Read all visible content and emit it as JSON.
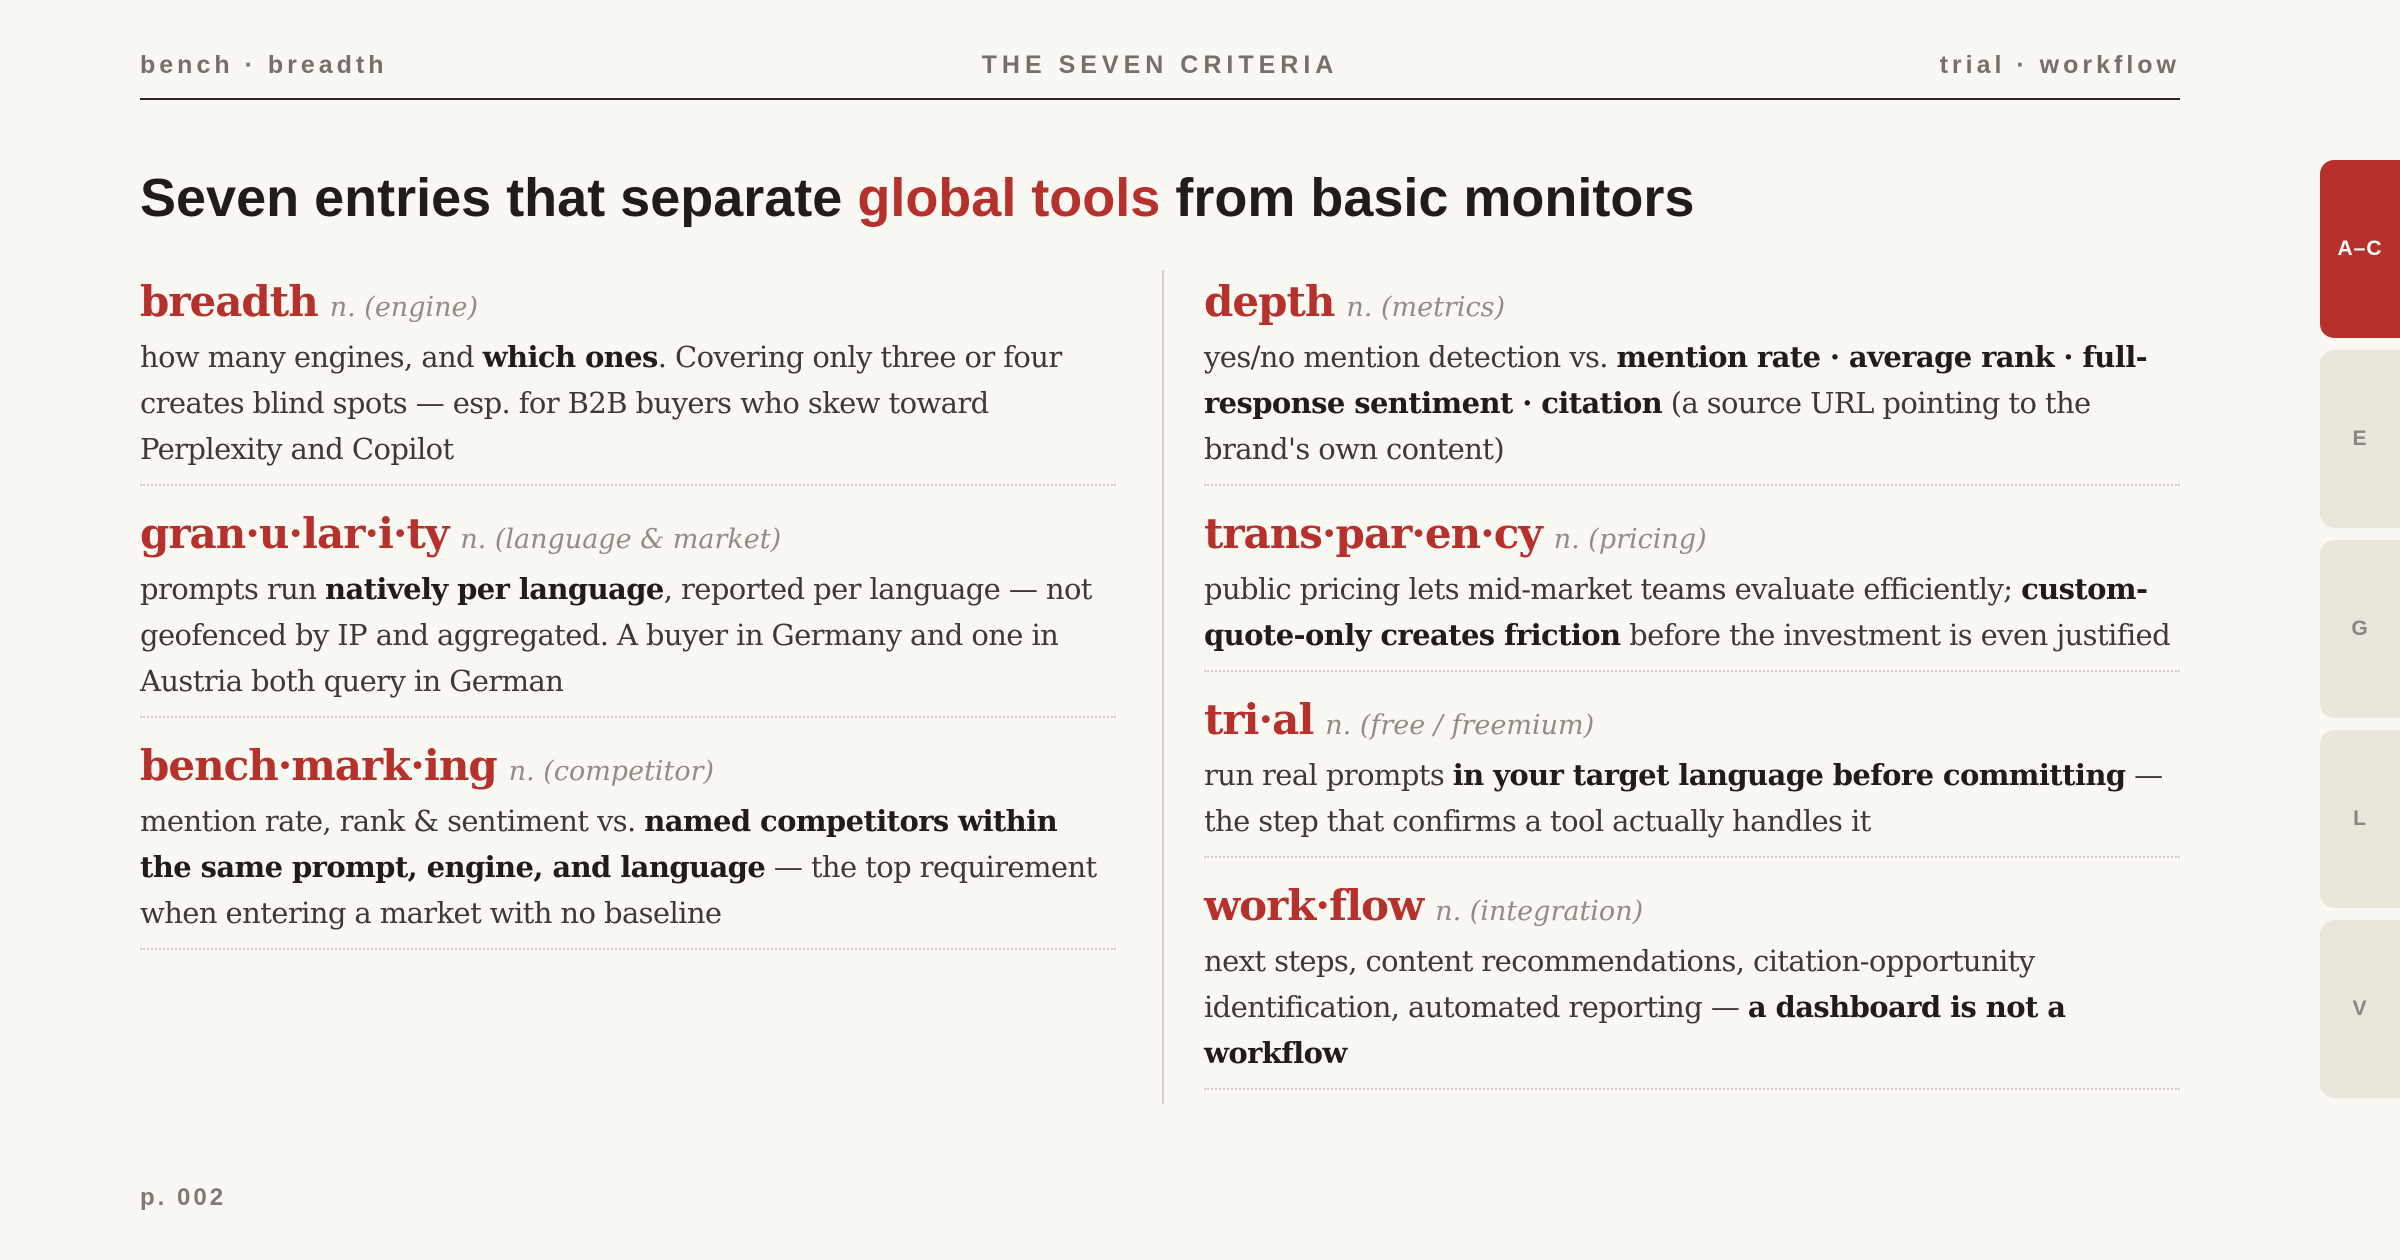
{
  "header": {
    "left": "bench · breadth",
    "center": "THE SEVEN CRITERIA",
    "right": "trial · workflow"
  },
  "headline": {
    "before": "Seven entries that separate ",
    "accent": "global tools",
    "after": " from basic monitors"
  },
  "entries_left": [
    {
      "term": "breadth",
      "pos": "n. (engine)",
      "def": [
        {
          "t": "how many engines, and "
        },
        {
          "t": "which ones",
          "b": true
        },
        {
          "t": ". Covering only three or four creates blind spots — esp. for B2B buyers who skew toward Perplexity and Copilot"
        }
      ]
    },
    {
      "term": "gran·u·lar·i·ty",
      "pos": "n. (language & market)",
      "def": [
        {
          "t": "prompts run "
        },
        {
          "t": "natively per language",
          "b": true
        },
        {
          "t": ", reported per language — not geofenced by IP and aggregated. A buyer in Germany and one in Austria both query in German"
        }
      ]
    },
    {
      "term": "bench·mark·ing",
      "pos": "n. (competitor)",
      "def": [
        {
          "t": "mention rate, rank & sentiment vs. "
        },
        {
          "t": "named competitors within the same prompt, engine, and language",
          "b": true
        },
        {
          "t": " — the top requirement when entering a market with no baseline"
        }
      ]
    }
  ],
  "entries_right": [
    {
      "term": "depth",
      "pos": "n. (metrics)",
      "def": [
        {
          "t": "yes/no mention detection vs. "
        },
        {
          "t": "mention rate · average rank · full-response sentiment · citation",
          "b": true
        },
        {
          "t": " (a source URL pointing to the brand's own content)"
        }
      ]
    },
    {
      "term": "trans·par·en·cy",
      "pos": "n. (pricing)",
      "def": [
        {
          "t": "public pricing lets mid-market teams evaluate efficiently; "
        },
        {
          "t": "custom-quote-only creates friction",
          "b": true
        },
        {
          "t": " before the investment is even justified"
        }
      ]
    },
    {
      "term": "tri·al",
      "pos": "n. (free / freemium)",
      "def": [
        {
          "t": "run real prompts "
        },
        {
          "t": "in your target language before committing",
          "b": true
        },
        {
          "t": " — the step that confirms a tool actually handles it"
        }
      ]
    },
    {
      "term": "work·flow",
      "pos": "n. (integration)",
      "def": [
        {
          "t": "next steps, content recommendations, citation-opportunity identification, automated reporting — "
        },
        {
          "t": "a dashboard is not a workflow",
          "b": true
        }
      ]
    }
  ],
  "tabs": [
    {
      "label": "A–C",
      "active": true
    },
    {
      "label": "E",
      "active": false
    },
    {
      "label": "G",
      "active": false
    },
    {
      "label": "L",
      "active": false
    },
    {
      "label": "V",
      "active": false
    }
  ],
  "footer": {
    "page": "p. 002"
  },
  "colors": {
    "accent": "#b7312c",
    "background": "#faf8f3",
    "tab_inactive": "#ebe6dc"
  }
}
